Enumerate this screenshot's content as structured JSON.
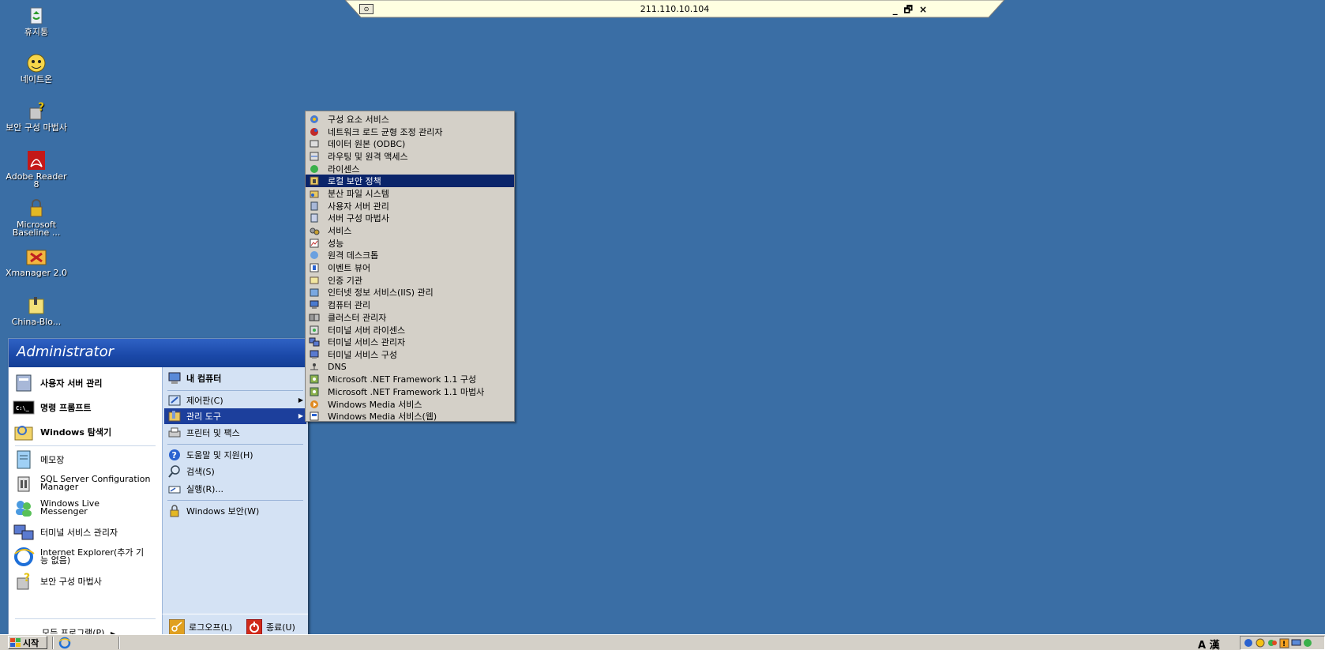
{
  "rdp_bar": {
    "title": "211.110.10.104",
    "pin_icon": "pin-icon",
    "controls": [
      "_",
      "🗗",
      "×"
    ]
  },
  "desktop_icons": [
    {
      "label": "휴지통",
      "icon": "recycle-bin-icon"
    },
    {
      "label": "네이트온",
      "icon": "nateon-icon"
    },
    {
      "label": "보안 구성 마법사",
      "icon": "security-wizard-icon"
    },
    {
      "label": "Adobe Reader 8",
      "icon": "adobe-reader-icon"
    },
    {
      "label": "Microsoft Baseline ...",
      "icon": "mbsa-icon"
    },
    {
      "label": "Xmanager 2.0",
      "icon": "xmanager-icon"
    },
    {
      "label": "China-Blo...",
      "icon": "folder-icon"
    }
  ],
  "start_menu": {
    "user": "Administrator",
    "left_pinned": [
      {
        "label": "사용자 서버 관리",
        "icon": "server-manage-icon"
      },
      {
        "label": "명령 프롬프트",
        "icon": "cmd-icon"
      },
      {
        "label": "Windows 탐색기",
        "icon": "explorer-icon"
      }
    ],
    "left_recent": [
      {
        "label": "메모장",
        "icon": "notepad-icon"
      },
      {
        "label": "SQL Server Configuration Manager",
        "icon": "sql-config-icon"
      },
      {
        "label": "Windows Live Messenger",
        "icon": "messenger-icon"
      },
      {
        "label": "터미널 서비스 관리자",
        "icon": "terminal-services-icon"
      },
      {
        "label": "Internet Explorer(추가 기능 없음)",
        "icon": "ie-icon"
      },
      {
        "label": "보안 구성 마법사",
        "icon": "security-wizard-icon"
      }
    ],
    "all_programs": "모든 프로그램(P)",
    "right_items": [
      {
        "label": "내 컴퓨터",
        "icon": "my-computer-icon"
      },
      {
        "label": "제어판(C)",
        "icon": "control-panel-icon"
      },
      {
        "label": "관리 도구",
        "icon": "admin-tools-icon"
      },
      {
        "label": "프린터 및 팩스",
        "icon": "printer-icon"
      },
      {
        "label": "도움말 및 지원(H)",
        "icon": "help-icon"
      },
      {
        "label": "검색(S)",
        "icon": "search-icon"
      },
      {
        "label": "실행(R)...",
        "icon": "run-icon"
      },
      {
        "label": "Windows 보안(W)",
        "icon": "windows-security-icon"
      }
    ],
    "logoff": "로그오프(L)",
    "shutdown": "종료(U)"
  },
  "admin_submenu": [
    {
      "label": "구성 요소 서비스"
    },
    {
      "label": "네트워크 로드 균형 조정 관리자"
    },
    {
      "label": "데이터 원본 (ODBC)"
    },
    {
      "label": "라우팅 및 원격 액세스"
    },
    {
      "label": "라이센스"
    },
    {
      "label": "로컬 보안 정책"
    },
    {
      "label": "분산 파일 시스템"
    },
    {
      "label": "사용자 서버 관리"
    },
    {
      "label": "서버 구성 마법사"
    },
    {
      "label": "서비스"
    },
    {
      "label": "성능"
    },
    {
      "label": "원격 데스크톱"
    },
    {
      "label": "이벤트 뷰어"
    },
    {
      "label": "인증 기관"
    },
    {
      "label": "인터넷 정보 서비스(IIS) 관리"
    },
    {
      "label": "컴퓨터 관리"
    },
    {
      "label": "클러스터 관리자"
    },
    {
      "label": "터미널 서버 라이센스"
    },
    {
      "label": "터미널 서비스 관리자"
    },
    {
      "label": "터미널 서비스 구성"
    },
    {
      "label": "DNS"
    },
    {
      "label": "Microsoft .NET Framework 1.1 구성"
    },
    {
      "label": "Microsoft .NET Framework 1.1 마법사"
    },
    {
      "label": "Windows Media 서비스"
    },
    {
      "label": "Windows Media 서비스(웹)"
    }
  ],
  "submenu_selected_index": 5,
  "taskbar": {
    "start_label": "시작",
    "ime_label": "A 漢"
  },
  "colors": {
    "desktop": "#3a6ea5",
    "selection": "#0a246a",
    "start_header": "#1a48a8"
  }
}
